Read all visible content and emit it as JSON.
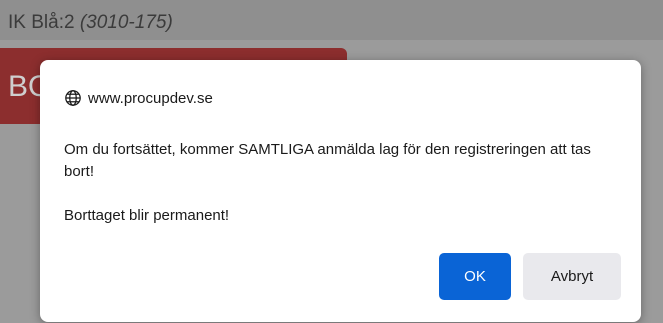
{
  "background_page": {
    "header_prefix": "IK Blå:2",
    "header_code": "(3010-175)",
    "red_button_label": "BO"
  },
  "dialog": {
    "origin": "www.procupdev.se",
    "origin_icon": "globe-icon",
    "message_line1": "Om du fortsättet, kommer SAMTLIGA anmälda lag för den registreringen att tas bort!",
    "message_line2": "Borttaget blir permanent!",
    "ok_label": "OK",
    "cancel_label": "Avbryt"
  },
  "colors": {
    "ok_button": "#0a64d6",
    "cancel_button": "#e9e9ed",
    "page_overlay": "#9b9b9b",
    "red_button": "#8c2e2e"
  }
}
